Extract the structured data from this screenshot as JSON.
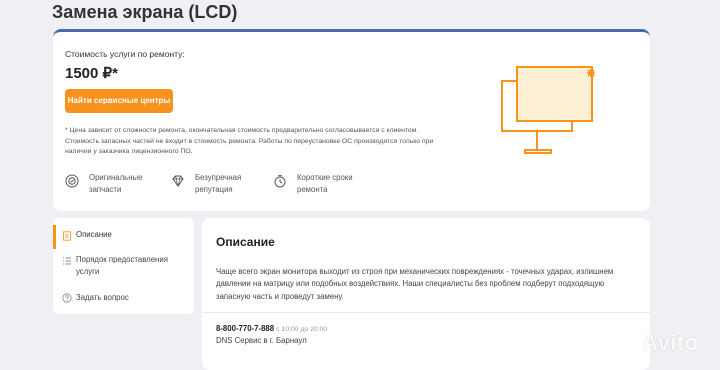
{
  "page": {
    "title": "Замена экрана (LCD)"
  },
  "price_card": {
    "label": "Стоимость услуги по ремонту:",
    "price": "1500 ₽*",
    "button_label": "Найти сервисные центры",
    "note": "* Цена зависит от сложности ремонта, окончательная стоимость предварительно согласовывается с клиентом. Стоимость запасных частей не входит в стоимость ремонта. Работы по переустановке ОС производятся только при наличии у заказчика лицензионного ПО.",
    "accent_color": "#f7931d",
    "top_border_color": "#4a68b2",
    "features": [
      {
        "label": "Оригинальные запчасти",
        "icon": "original-parts-icon"
      },
      {
        "label": "Безупречная репутация",
        "icon": "diamond-icon"
      },
      {
        "label": "Короткие сроки ремонта",
        "icon": "stopwatch-icon"
      }
    ]
  },
  "sidebar": {
    "items": [
      {
        "label": "Описание",
        "icon": "document-icon",
        "active": true
      },
      {
        "label": "Порядок предоставления услуги",
        "icon": "list-icon",
        "active": false
      },
      {
        "label": "Задать вопрос",
        "icon": "question-icon",
        "active": false
      }
    ]
  },
  "description": {
    "title": "Описание",
    "text": "Чаще всего экран монитора выходит из строя при механических повреждениях - точечных ударах, излишнем давлении на матрицу или подобных воздействиях. Наши специалисты без проблем подберут подходящую запасную часть и проведут замену.",
    "phone": "8-800-770-7-888",
    "hours": "с 10:00 до 20:00",
    "shop": "DNS Сервис в г. Барнаул"
  },
  "watermark": {
    "text": "Avito"
  }
}
